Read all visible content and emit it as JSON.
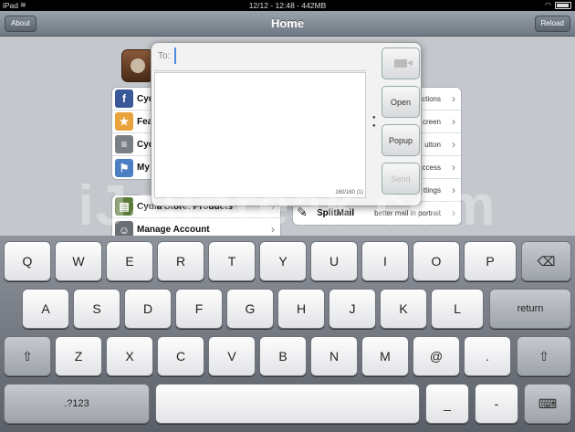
{
  "status": {
    "device": "iPad",
    "time": "12/12 - 12:48 - 442MB"
  },
  "navbar": {
    "title": "Home",
    "left_button": "About",
    "right_button": "Reload"
  },
  "sections_left": [
    {
      "label": "Cyd",
      "icon": "f"
    },
    {
      "label": "Fea",
      "icon": "★"
    },
    {
      "label": "Cyd",
      "icon": "≡"
    },
    {
      "label": "My",
      "icon": "⚑"
    }
  ],
  "section_left_bottom": [
    {
      "label": "Cydia Store: Products",
      "icon": "▤"
    },
    {
      "label": "Manage Account",
      "icon": "☺"
    }
  ],
  "sections_right": [
    {
      "subtitle": "ctions"
    },
    {
      "subtitle": "creen"
    },
    {
      "subtitle": "utton"
    },
    {
      "subtitle": "ccess"
    },
    {
      "subtitle": "ttings"
    },
    {
      "label": "SplitMail",
      "subtitle": "better mail in portrait"
    }
  ],
  "popup": {
    "to_label": "To:",
    "to_value": "",
    "counter": "160/160 (1)",
    "buttons": {
      "open": "Open",
      "popup": "Popup",
      "send": "Send"
    }
  },
  "watermark": "iJailbreak.com",
  "keyboard": {
    "row1": [
      "Q",
      "W",
      "E",
      "R",
      "T",
      "Y",
      "U",
      "I",
      "O",
      "P"
    ],
    "row2": [
      "A",
      "S",
      "D",
      "F",
      "G",
      "H",
      "J",
      "K",
      "L"
    ],
    "row3": [
      "Z",
      "X",
      "C",
      "V",
      "B",
      "N",
      "M",
      "@",
      "."
    ],
    "return": "return",
    "numbers": ".?123",
    "underscore": "_",
    "dash": "-",
    "shift": "⇧",
    "backspace": "⌫",
    "hide": "⌨"
  }
}
